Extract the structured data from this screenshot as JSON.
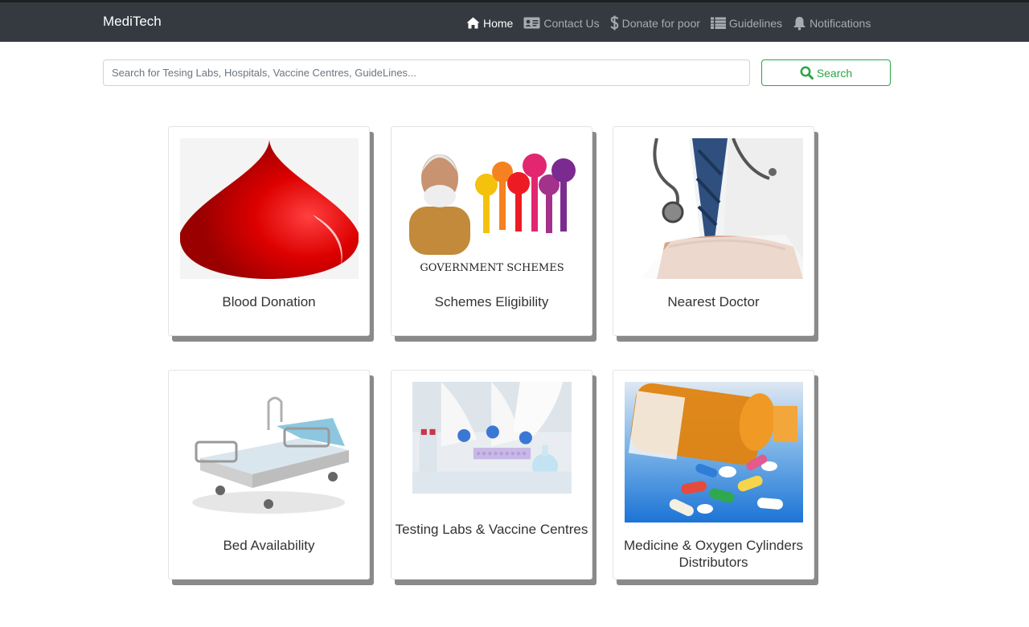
{
  "navbar": {
    "brand": "MediTech",
    "items": [
      {
        "label": "Home",
        "icon": "home-icon",
        "active": true
      },
      {
        "label": "Contact Us",
        "icon": "address-card-icon",
        "active": false
      },
      {
        "label": "Donate for poor",
        "icon": "dollar-icon",
        "active": false
      },
      {
        "label": "Guidelines",
        "icon": "list-icon",
        "active": false
      },
      {
        "label": "Notifications",
        "icon": "bell-icon",
        "active": false
      }
    ]
  },
  "search": {
    "placeholder": "Search for Tesing Labs, Hospitals, Vaccine Centres, GuideLines...",
    "value": "",
    "button_label": "Search"
  },
  "cards": [
    {
      "title": "Blood Donation",
      "image": "blood-drop-image"
    },
    {
      "title": "Schemes Eligibility",
      "image": "government-schemes-image",
      "image_caption": "GOVERNMENT SCHEMES"
    },
    {
      "title": "Nearest Doctor",
      "image": "doctor-stethoscope-image"
    },
    {
      "title": "Bed Availability",
      "image": "hospital-bed-image"
    },
    {
      "title": "Testing Labs & Vaccine Centres",
      "image": "laboratory-image"
    },
    {
      "title": "Medicine & Oxygen Cylinders Distributors",
      "image": "medicine-pills-image"
    }
  ],
  "colors": {
    "navbar_bg": "#343a40",
    "search_accent": "#28a745",
    "card_shadow": "#8a8a8a"
  }
}
